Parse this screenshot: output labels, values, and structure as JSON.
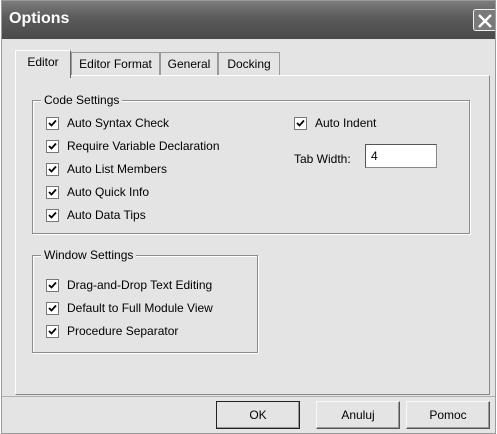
{
  "window": {
    "title": "Options"
  },
  "tabs": [
    {
      "label": "Editor",
      "active": true
    },
    {
      "label": "Editor Format",
      "active": false
    },
    {
      "label": "General",
      "active": false
    },
    {
      "label": "Docking",
      "active": false
    }
  ],
  "code_settings": {
    "legend": "Code Settings",
    "options": [
      {
        "label": "Auto Syntax Check",
        "checked": true
      },
      {
        "label": "Require Variable Declaration",
        "checked": true
      },
      {
        "label": "Auto List Members",
        "checked": true
      },
      {
        "label": "Auto Quick Info",
        "checked": true
      },
      {
        "label": "Auto Data Tips",
        "checked": true
      }
    ],
    "auto_indent": {
      "label": "Auto Indent",
      "checked": true
    },
    "tab_width": {
      "label": "Tab Width:",
      "value": "4"
    }
  },
  "window_settings": {
    "legend": "Window Settings",
    "options": [
      {
        "label": "Drag-and-Drop Text Editing",
        "checked": true
      },
      {
        "label": "Default to Full Module View",
        "checked": true
      },
      {
        "label": "Procedure Separator",
        "checked": true
      }
    ]
  },
  "buttons": {
    "ok": "OK",
    "cancel": "Anuluj",
    "help": "Pomoc"
  },
  "icons": {
    "close": "close-icon",
    "check": "checkmark-icon"
  },
  "colors": {
    "titlebar": "#5a5a5a",
    "dialog_bg": "#e4e4e4"
  }
}
